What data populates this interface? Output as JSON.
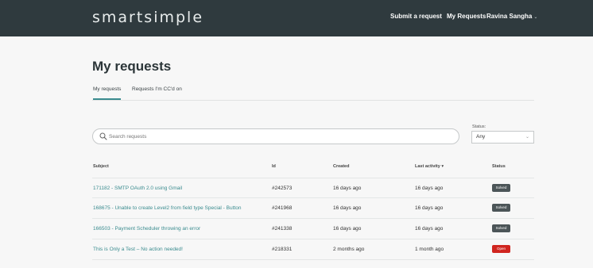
{
  "header": {
    "logo": "smartsimple",
    "nav_submit": "Submit a request",
    "nav_my_requests": "My Requests",
    "user_name": "Ravina Sangha"
  },
  "page": {
    "title": "My requests"
  },
  "tabs": [
    {
      "label": "My requests",
      "active": true
    },
    {
      "label": "Requests I'm CC'd on",
      "active": false
    }
  ],
  "search": {
    "placeholder": "Search requests",
    "value": ""
  },
  "status_filter": {
    "label": "Status:",
    "selected": "Any"
  },
  "table": {
    "headers": {
      "subject": "Subject",
      "id": "Id",
      "created": "Created",
      "last_activity": "Last activity ▾",
      "status": "Status"
    },
    "rows": [
      {
        "subject": "171182 - SMTP OAuth 2.0 using Gmail",
        "id": "#242573",
        "created": "16 days ago",
        "last_activity": "16 days ago",
        "status": "Solved"
      },
      {
        "subject": "168675 - Unable to create Level2 from field type Special - Button",
        "id": "#241968",
        "created": "16 days ago",
        "last_activity": "16 days ago",
        "status": "Solved"
      },
      {
        "subject": "166503 - Payment Scheduler throwing an error",
        "id": "#241338",
        "created": "16 days ago",
        "last_activity": "16 days ago",
        "status": "Solved"
      },
      {
        "subject": "This is Only a Test – No action needed!",
        "id": "#218331",
        "created": "2 months ago",
        "last_activity": "1 month ago",
        "status": "Open"
      }
    ]
  },
  "colors": {
    "header_bg": "#2f3a3e",
    "accent": "#3b8c8f",
    "solved_badge": "#4c5558",
    "open_badge": "#d0251f"
  },
  "icons": {
    "search": "search-icon",
    "select_chevron": "chevron-down-icon",
    "user_caret": "caret-down-icon"
  }
}
